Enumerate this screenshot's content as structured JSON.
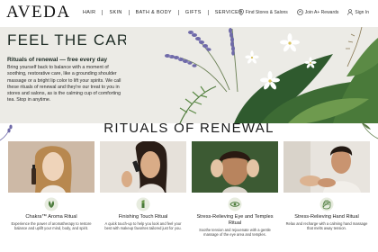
{
  "brand": {
    "logo": "AVEDA"
  },
  "nav": {
    "items": [
      "HAIR",
      "SKIN",
      "BATH & BODY",
      "GIFTS",
      "SERVICES"
    ]
  },
  "utility": {
    "stores": "Find Stores & Salons",
    "rewards": "Join A+ Rewards",
    "signin": "Sign In"
  },
  "hero": {
    "title": "FEEL THE CARE",
    "subtitle": "Rituals of renewal — free every day",
    "body": "Bring yourself back to balance with a moment of soothing, restorative care, like a grounding shoulder massage or a bright lip color to lift your spirits. We call these rituals of renewal and they're our treat to you in stores and salons, as is the calming cup of comforting tea. Stop in anytime."
  },
  "rituals": {
    "title": "RITUALS OF RENEWAL",
    "cards": [
      {
        "title": "Chakra™ Aroma Ritual",
        "desc": "Experience the power of aromatherapy to restore balance and uplift your mind, body, and spirit."
      },
      {
        "title": "Finishing Touch Ritual",
        "desc": "A quick touch-up to help you look and feel your best with makeup favorites tailored just for you."
      },
      {
        "title": "Stress-Relieving Eye and Temples Ritual",
        "desc": "Soothe tension and rejuvenate with a gentle massage of the eye area and temples."
      },
      {
        "title": "Stress-Relieving Hand Ritual",
        "desc": "Relax and recharge with a calming hand massage that melts away tension."
      }
    ]
  },
  "colors": {
    "hero_bg": "#ecebe6",
    "accent_green": "#2f5a2e",
    "lavender": "#6f6aa8"
  }
}
